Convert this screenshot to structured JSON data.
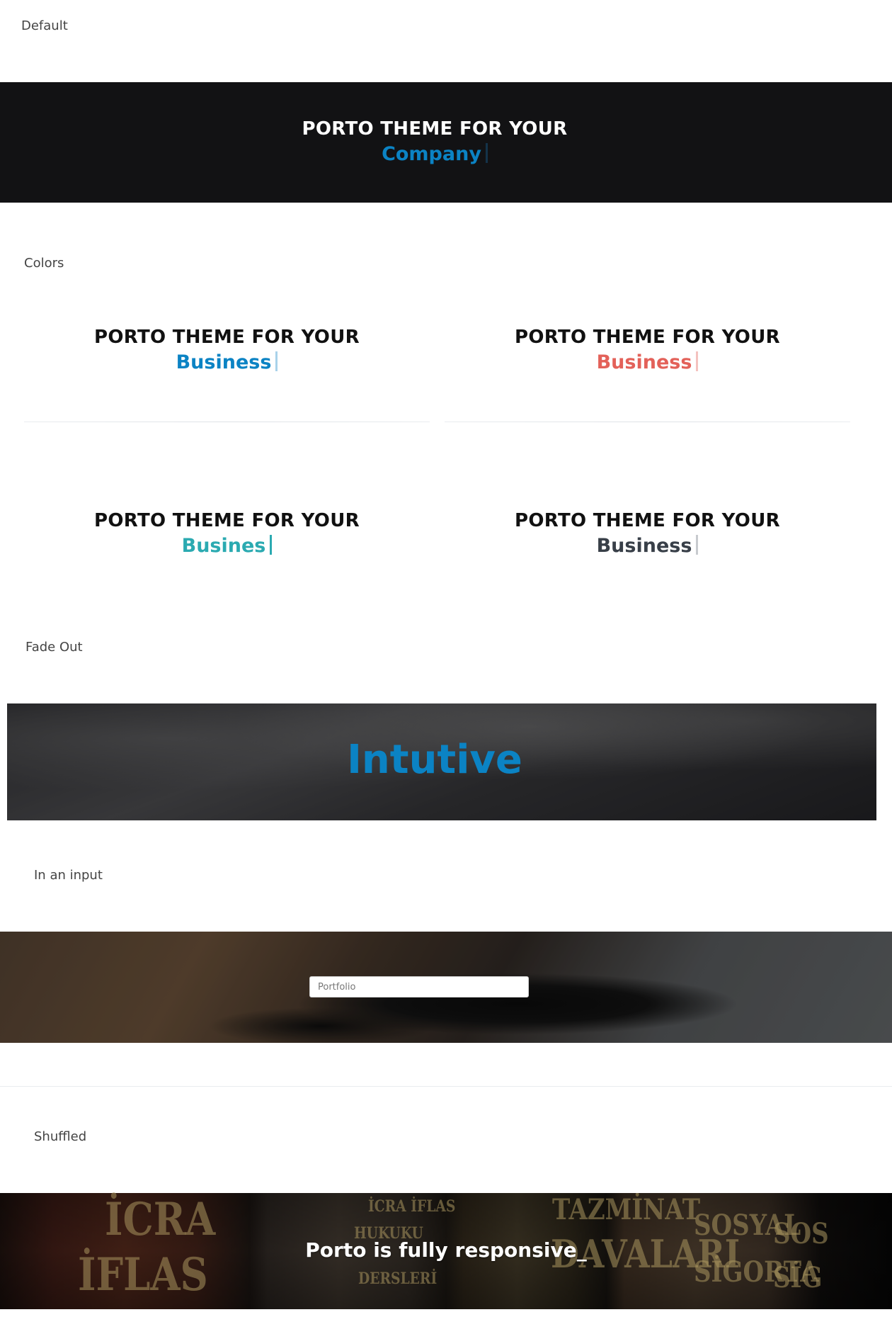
{
  "sections": {
    "default_label": "Default",
    "colors_label": "Colors",
    "fadeout_label": "Fade Out",
    "input_label": "In an input",
    "shuffled_label": "Shuffled"
  },
  "default_demo": {
    "heading": "PORTO THEME FOR YOUR",
    "word": "Company",
    "word_color": "#0b83c4"
  },
  "color_demos": [
    {
      "heading": "PORTO THEME FOR YOUR",
      "word": "Business",
      "word_color": "#0b83c4"
    },
    {
      "heading": "PORTO THEME FOR YOUR",
      "word": "Business",
      "word_color": "#e36159"
    },
    {
      "heading": "PORTO THEME FOR YOUR",
      "word": "Busines",
      "word_color": "#2baab1"
    },
    {
      "heading": "PORTO THEME FOR YOUR",
      "word": "Business",
      "word_color": "#383f48"
    }
  ],
  "fadeout_demo": {
    "word": "Intutive",
    "word_color": "#0b83c4"
  },
  "input_demo": {
    "value": "Portfolio"
  },
  "shuffled_demo": {
    "text": "Porto is fully responsive_",
    "background_words": [
      "İCRA",
      "İFLAS",
      "İCRA İFLAS",
      "HUKUKU",
      "DERSLERİ",
      "TAZMİNAT",
      "DAVALARI",
      "SOSYAL",
      "SİGORTA",
      "SOS",
      "SİG"
    ]
  }
}
